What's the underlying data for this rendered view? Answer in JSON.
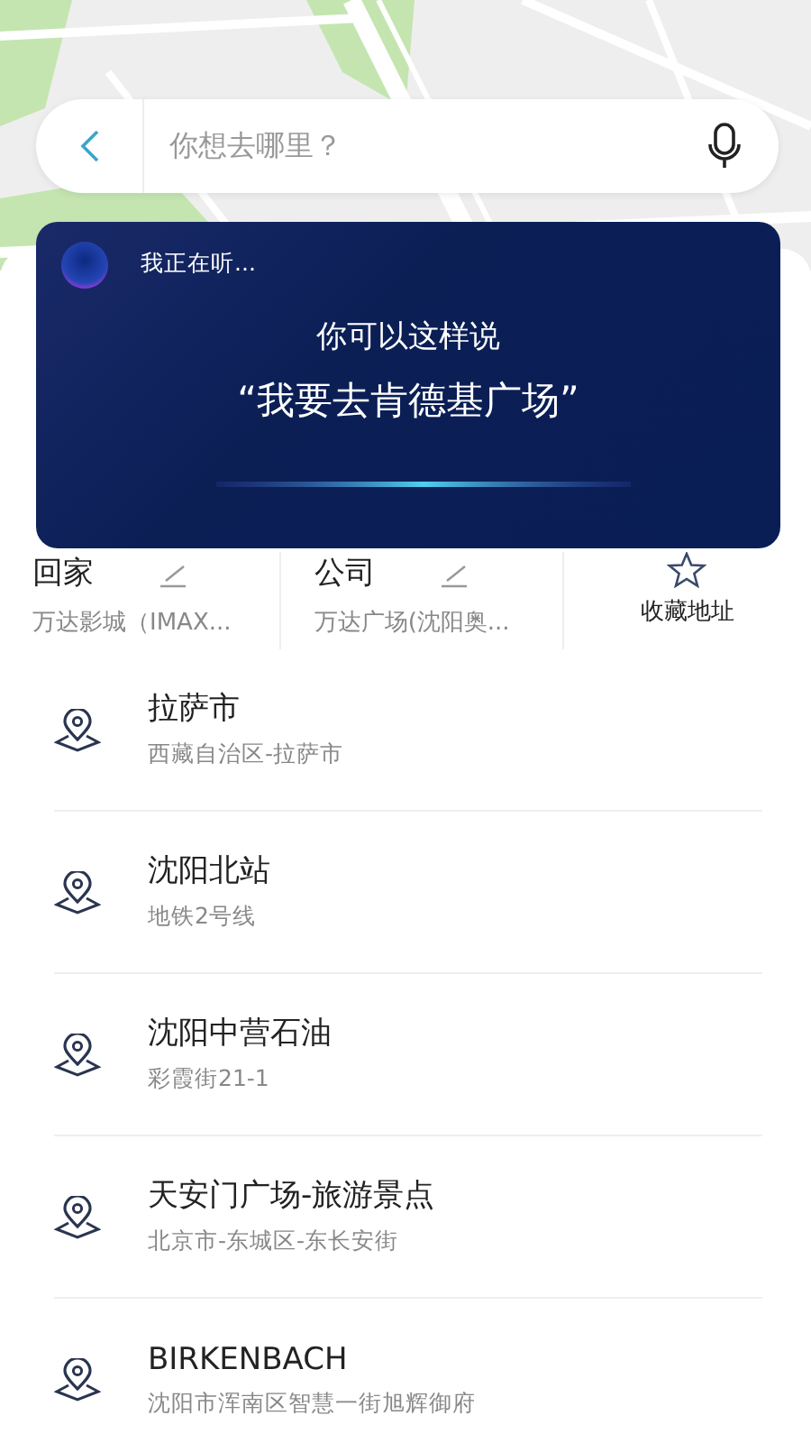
{
  "search": {
    "placeholder": "你想去哪里？"
  },
  "voice": {
    "status": "我正在听...",
    "hint": "你可以这样说",
    "example": "“我要去肯德基广场”"
  },
  "shortcuts": [
    {
      "kind": "place",
      "label": "回家",
      "address": "万达影城（IMAX..."
    },
    {
      "kind": "place",
      "label": "公司",
      "address": "万达广场(沈阳奥..."
    },
    {
      "kind": "favorites",
      "label": "收藏地址"
    }
  ],
  "history": [
    {
      "name": "拉萨市",
      "address": "西藏自治区-拉萨市"
    },
    {
      "name": "沈阳北站",
      "address": "地铁2号线"
    },
    {
      "name": "沈阳中营石油",
      "address": "彩霞街21-1"
    },
    {
      "name": "天安门广场-旅游景点",
      "address": "北京市-东城区-东长安街"
    },
    {
      "name": "BIRKENBACH",
      "address": "沈阳市浑南区智慧一街旭辉御府"
    }
  ]
}
